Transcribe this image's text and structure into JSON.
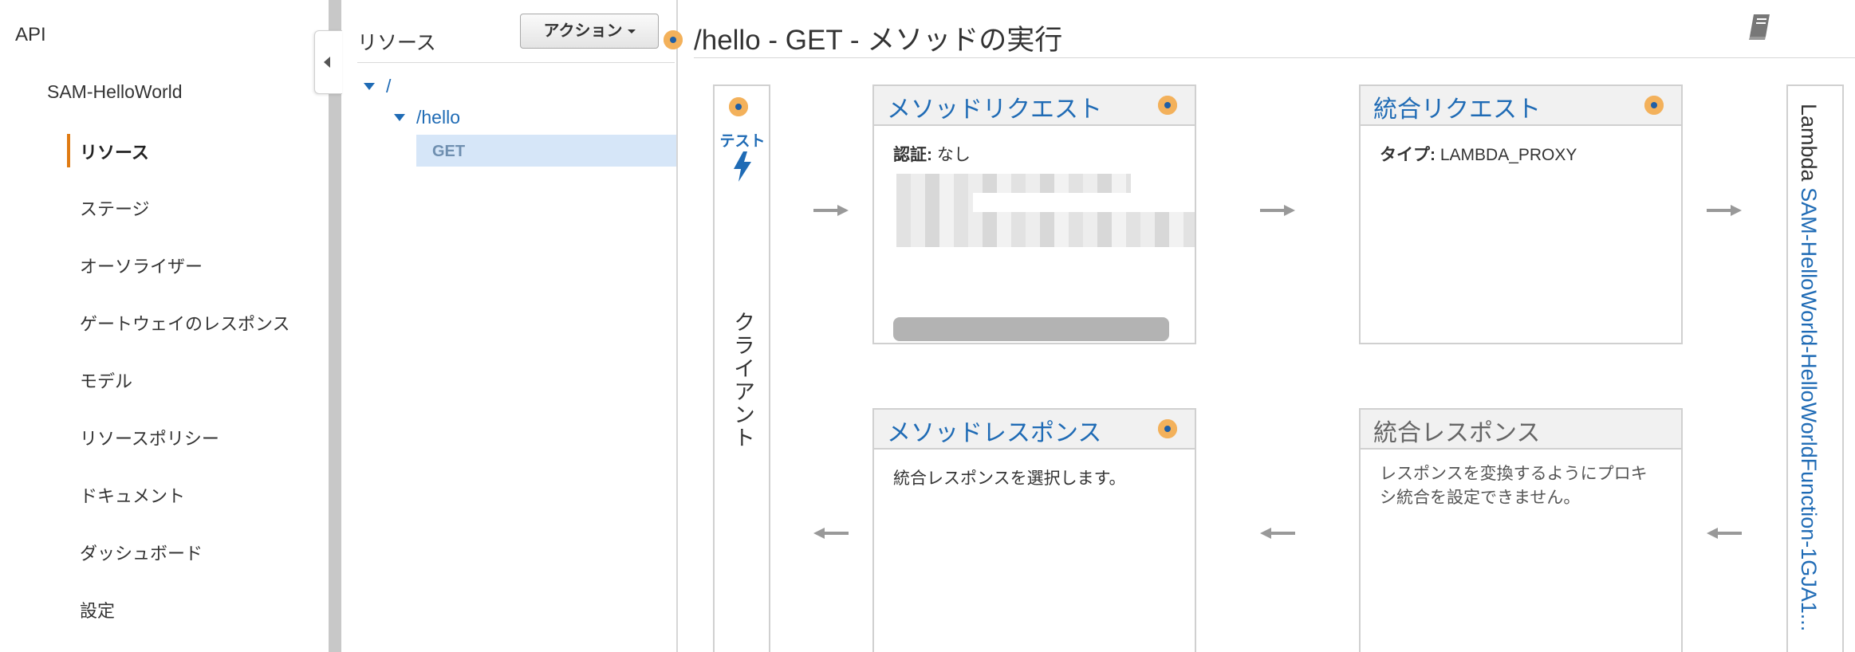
{
  "nav": {
    "api": "API",
    "app_name": "SAM-HelloWorld",
    "items": [
      {
        "label": "リソース",
        "active": true
      },
      {
        "label": "ステージ"
      },
      {
        "label": "オーソライザー"
      },
      {
        "label": "ゲートウェイのレスポンス"
      },
      {
        "label": "モデル"
      },
      {
        "label": "リソースポリシー"
      },
      {
        "label": "ドキュメント"
      },
      {
        "label": "ダッシュボード"
      },
      {
        "label": "設定"
      }
    ]
  },
  "tree": {
    "title": "リソース",
    "action_button": "アクション",
    "root": "/",
    "child": "/hello",
    "method": "GET"
  },
  "main": {
    "title": "/hello - GET - メソッドの実行",
    "client": {
      "test_label": "テスト",
      "label": "クライアント"
    },
    "method_request": {
      "title": "メソッドリクエスト",
      "auth_label": "認証:",
      "auth_value": "なし"
    },
    "integration_request": {
      "title": "統合リクエスト",
      "type_label": "タイプ:",
      "type_value": "LAMBDA_PROXY"
    },
    "method_response": {
      "title": "メソッドレスポンス",
      "body": "統合レスポンスを選択します。"
    },
    "integration_response": {
      "title": "統合レスポンス",
      "body_line1": "レスポンスを変換するようにプロキ",
      "body_line2": "シ統合を設定できません。"
    },
    "lambda": {
      "label": "Lambda",
      "function": "SAM-HelloWorld-HelloWorldFunction-1GJA1..."
    }
  },
  "colors": {
    "accent": "#1f6bb5",
    "nav_active": "#e07b13",
    "info_dot": "#f3b15b",
    "selected_row": "#d6e6f8"
  },
  "icons": [
    "book-icon",
    "info-icon",
    "bolt-icon",
    "arrow-right-icon",
    "arrow-left-icon",
    "caret-down-icon",
    "collapse-icon"
  ]
}
